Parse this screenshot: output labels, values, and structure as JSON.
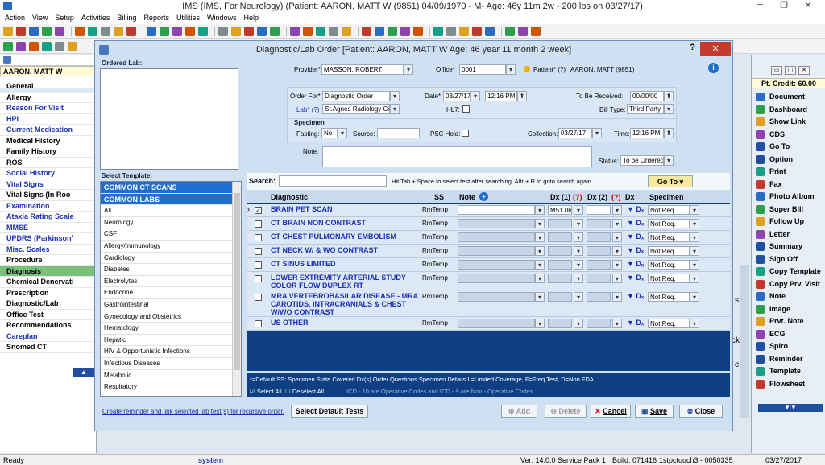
{
  "window": {
    "title": "IMS (IMS, For Neurology)    (Patient: AARON, MATT W (9851) 04/09/1970 - M- Age: 46y 11m 2w - 200 lbs on 03/27/17)"
  },
  "menu": [
    "Action",
    "View",
    "Setup",
    "Activities",
    "Billing",
    "Reports",
    "Utilities",
    "Windows",
    "Help"
  ],
  "left": {
    "patient": "AARON, MATT W",
    "items": [
      {
        "label": "General",
        "style": "black"
      },
      {
        "label": "Allergy",
        "style": "black"
      },
      {
        "label": "Reason For Visit",
        "style": "blue"
      },
      {
        "label": "HPI",
        "style": "blue"
      },
      {
        "label": "Current Medication",
        "style": "blue"
      },
      {
        "label": "Medical History",
        "style": "black"
      },
      {
        "label": "Family History",
        "style": "black"
      },
      {
        "label": "ROS",
        "style": "black"
      },
      {
        "label": "Social History",
        "style": "blue"
      },
      {
        "label": "Vital Signs",
        "style": "blue"
      },
      {
        "label": "Vital Signs (In Roo",
        "style": "black"
      },
      {
        "label": "Examination",
        "style": "blue"
      },
      {
        "label": "Ataxia Rating Scale",
        "style": "blue"
      },
      {
        "label": "MMSE",
        "style": "blue"
      },
      {
        "label": "UPDRS (Parkinson'",
        "style": "blue"
      },
      {
        "label": "Misc. Scales",
        "style": "blue"
      },
      {
        "label": "Procedure",
        "style": "black"
      },
      {
        "label": "Diagnosis",
        "style": "dx"
      },
      {
        "label": "Chemical Denervati",
        "style": "black"
      },
      {
        "label": "Prescription",
        "style": "black"
      },
      {
        "label": "Diagnostic/Lab",
        "style": "black"
      },
      {
        "label": "Office Test",
        "style": "black"
      },
      {
        "label": "Recommendations",
        "style": "black"
      },
      {
        "label": "Careplan",
        "style": "blue"
      },
      {
        "label": "Snomed CT",
        "style": "black"
      }
    ]
  },
  "right": {
    "credit": "Pt. Credit: 60.00",
    "items": [
      "Document",
      "Dashboard",
      "Show Link",
      "CDS",
      "Go To",
      "Option",
      "Print",
      "Fax",
      "Photo Album",
      "Super Bill",
      "Follow Up",
      "Letter",
      "Summary",
      "Sign Off",
      "Copy Template",
      "Copy Prv. Visit",
      "Note",
      "Image",
      "Prvt. Note",
      "ECG",
      "Spiro",
      "Reminder",
      "Template",
      "Flowsheet"
    ]
  },
  "dialog": {
    "title": "Diagnostic/Lab Order  [Patient: AARON, MATT W  Age: 46 year 11 month 2 week]",
    "help": "?",
    "close": "✕",
    "ordered_lab_label": "Ordered Lab:",
    "provider_label": "Provider*",
    "provider": "MASSON, ROBERT",
    "office_label": "Office*",
    "office": "0001",
    "patient_label": "Patient* (?)",
    "patient": "AARON, MATT  (9851)",
    "order_for_label": "Order For*",
    "order_for": "Diagnostic Order",
    "date_label": "Date*",
    "date": "03/27/17",
    "time": "12:16 PM",
    "to_be_received_label": "To Be Received:",
    "to_be_received": "00/00/00",
    "lab_label": "Lab* (?)",
    "lab": "St.Agnes Radiology Center",
    "hl7_label": "HL7:",
    "bill_type_label": "Bill Type:",
    "bill_type": "Third Party",
    "specimen_label": "Specimen",
    "fasting_label": "Fasting:",
    "fasting": "No",
    "source_label": "Source:",
    "psc_hold_label": "PSC Hold:",
    "collection_label": "Collection:",
    "collection_date": "03/27/17",
    "time_label": "Time:",
    "collection_time": "12:16 PM",
    "note_label": "Note:",
    "status_label": "Status:",
    "status": "To be Ordered",
    "select_template_label": "Select Template:",
    "templates": [
      "COMMON CT SCANS",
      "COMMON LABS",
      "All",
      "Neurology",
      "CSF",
      "Allergy/Immunology",
      "Cardiology",
      "Diabetes",
      "Electrolytes",
      "Endocrine",
      "Gastrointestinal",
      "Gynecology and Obstetrics",
      "Hematology",
      "Hepatic",
      "HIV & Opportunistic Infections",
      "Infectious Diseases",
      "Metabolic",
      "Respiratory"
    ],
    "search_label": "Search:",
    "search_hint": "Hit Tab + Space to select test after searching. Altr + R to goto search again.",
    "goto_button": "Go To",
    "columns": {
      "diagnostic": "Diagnostic",
      "ss": "SS",
      "note": "Note",
      "dx1": "Dx (1)",
      "q1": "(?)",
      "dx2": "Dx (2)",
      "q2": "(?)",
      "dx": "Dx",
      "specimen": "Specimen"
    },
    "rows": [
      {
        "name": "BRAIN PET SCAN",
        "ss": "RmTemp",
        "dx1": "M51.06",
        "specimen": "Not Req.",
        "checked": true
      },
      {
        "name": "CT BRAIN NON CONTRAST",
        "ss": "RmTemp",
        "dx1": "",
        "specimen": "Not Req.",
        "checked": false
      },
      {
        "name": "CT CHEST PULMONARY EMBOLISM",
        "ss": "RmTemp",
        "dx1": "",
        "specimen": "Not Req.",
        "checked": false
      },
      {
        "name": "CT NECK W/ & WO CONTRAST",
        "ss": "RmTemp",
        "dx1": "",
        "specimen": "Not Req.",
        "checked": false
      },
      {
        "name": "CT SINUS LIMITED",
        "ss": "RmTemp",
        "dx1": "",
        "specimen": "Not Req.",
        "checked": false
      },
      {
        "name": "LOWER EXTREMITY ARTERIAL STUDY - COLOR FLOW DUPLEX RT",
        "ss": "RmTemp",
        "dx1": "",
        "specimen": "Not Req.",
        "checked": false
      },
      {
        "name": "MRA VERTEBROBASILAR DISEASE - MRA CAROTIDS, INTRACRANIALS & CHEST W/WO CONTRAST",
        "ss": "RmTemp",
        "dx1": "",
        "specimen": "Not Req.",
        "checked": false
      },
      {
        "name": "US OTHER",
        "ss": "RmTemp",
        "dx1": "",
        "specimen": "Not Req.",
        "checked": false
      }
    ],
    "legend": "*=Default  SS: Specimen State   Covered Dx(s)   Order Questions   Specimen Details   L=Limited Coverage, F=Freq.Test, D=Non FDA",
    "select_all": "Select All",
    "deselect_all": "Deselect All",
    "icd_note": "ICD - 10 are Operative Codes and ICD - 9 are Non - Operative Codes",
    "reminder_link": "Create reminder and link selected lab test(s) for recursive order.",
    "select_default_btn": "Select Default Tests",
    "add_btn": "Add",
    "delete_btn": "Delete",
    "cancel_btn": "Cancel",
    "save_btn": "Save",
    "close_btn": "Close"
  },
  "status": {
    "ready": "Ready",
    "user": "system",
    "version": "Ver: 14.0.0 Service Pack 1",
    "build": "Build: 071416",
    "station": "1stpctouch3 - 0050335",
    "date": "03/27/2017"
  },
  "colors": {
    "accent": "#1f6fd0",
    "grid_bg": "#0d3f82",
    "dialog_bg": "#cfe0f3",
    "close_red": "#c83a2e"
  }
}
